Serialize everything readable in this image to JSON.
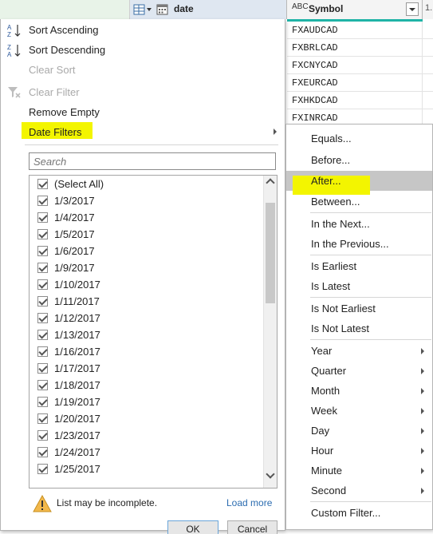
{
  "grid": {
    "date_column": {
      "label": "date",
      "type_icon": "table-type-icon",
      "calendar_icon": "calendar-icon"
    },
    "symbol_column": {
      "type_badge": "ABC",
      "label": "Symbol"
    },
    "next_column": {
      "label": "1."
    },
    "symbol_rows": [
      "FXAUDCAD",
      "FXBRLCAD",
      "FXCNYCAD",
      "FXEURCAD",
      "FXHKDCAD",
      "FXINRCAD"
    ]
  },
  "menu": {
    "sort_ascending": "Sort Ascending",
    "sort_descending": "Sort Descending",
    "clear_sort": "Clear Sort",
    "clear_filter": "Clear Filter",
    "remove_empty": "Remove Empty",
    "date_filters": "Date Filters"
  },
  "search": {
    "placeholder": "Search"
  },
  "values": [
    "(Select All)",
    "1/3/2017",
    "1/4/2017",
    "1/5/2017",
    "1/6/2017",
    "1/9/2017",
    "1/10/2017",
    "1/11/2017",
    "1/12/2017",
    "1/13/2017",
    "1/16/2017",
    "1/17/2017",
    "1/18/2017",
    "1/19/2017",
    "1/20/2017",
    "1/23/2017",
    "1/24/2017",
    "1/25/2017"
  ],
  "footer": {
    "warning": "List may be incomplete.",
    "load_more": "Load more",
    "ok": "OK",
    "cancel": "Cancel"
  },
  "submenu": {
    "equals": "Equals...",
    "before": "Before...",
    "after": "After...",
    "between": "Between...",
    "in_the_next": "In the Next...",
    "in_the_previous": "In the Previous...",
    "is_earliest": "Is Earliest",
    "is_latest": "Is Latest",
    "is_not_earliest": "Is Not Earliest",
    "is_not_latest": "Is Not Latest",
    "year": "Year",
    "quarter": "Quarter",
    "month": "Month",
    "week": "Week",
    "day": "Day",
    "hour": "Hour",
    "minute": "Minute",
    "second": "Second",
    "custom_filter": "Custom Filter..."
  },
  "colors": {
    "highlight": "#f3f500",
    "accent": "#1fb3a6",
    "link": "#2b6cb0",
    "hover": "#c6c6c6"
  }
}
